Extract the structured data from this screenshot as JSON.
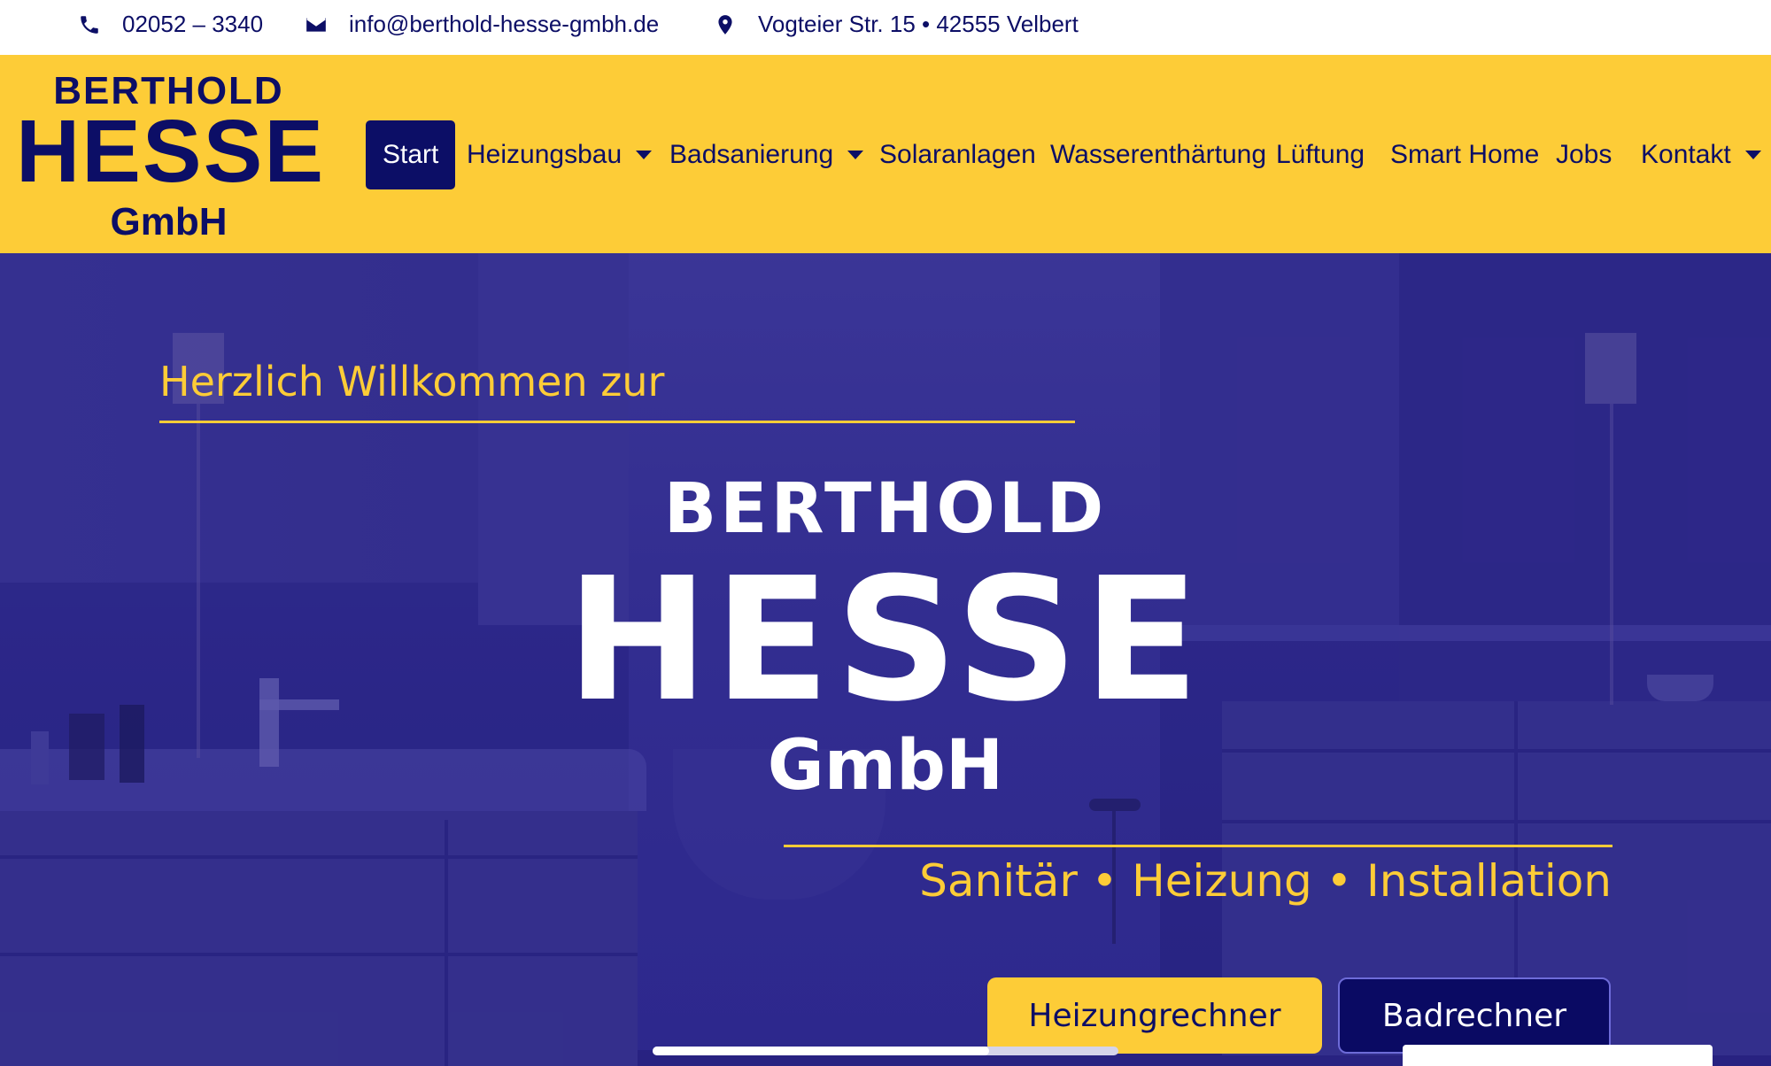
{
  "topbar": {
    "phone": "02052 – 3340",
    "email": "info@berthold-hesse-gmbh.de",
    "address": "Vogteier Str. 15 • 42555 Velbert",
    "icons": [
      "phone-icon",
      "envelope-icon",
      "map-pin-icon"
    ]
  },
  "logo": {
    "line1": "BERTHOLD",
    "line2": "HESSE",
    "line3": "GmbH"
  },
  "nav": {
    "items": [
      {
        "label": "Start",
        "active": true
      },
      {
        "label": "Heizungsbau",
        "dropdown": true
      },
      {
        "label": "Badsanierung",
        "dropdown": true
      },
      {
        "label": "Solaranlagen"
      },
      {
        "label": "Wasserenthärtung"
      },
      {
        "label": "Lüftung"
      },
      {
        "label": "Smart Home"
      },
      {
        "label": "Jobs"
      },
      {
        "label": "Kontakt",
        "dropdown": true
      }
    ]
  },
  "hero": {
    "welcome": "Herzlich Willkommen zur",
    "brand_line1": "BERTHOLD",
    "brand_line2": "HESSE",
    "brand_line3": "GmbH",
    "tagline": "Sanitär • Heizung • Installation",
    "button_primary": "Heizungrechner",
    "button_secondary": "Badrechner"
  },
  "colors": {
    "brand_yellow": "#fdcc37",
    "brand_navy": "#0c0e66",
    "hero_overlay": "#2e2a8a",
    "white": "#ffffff"
  }
}
